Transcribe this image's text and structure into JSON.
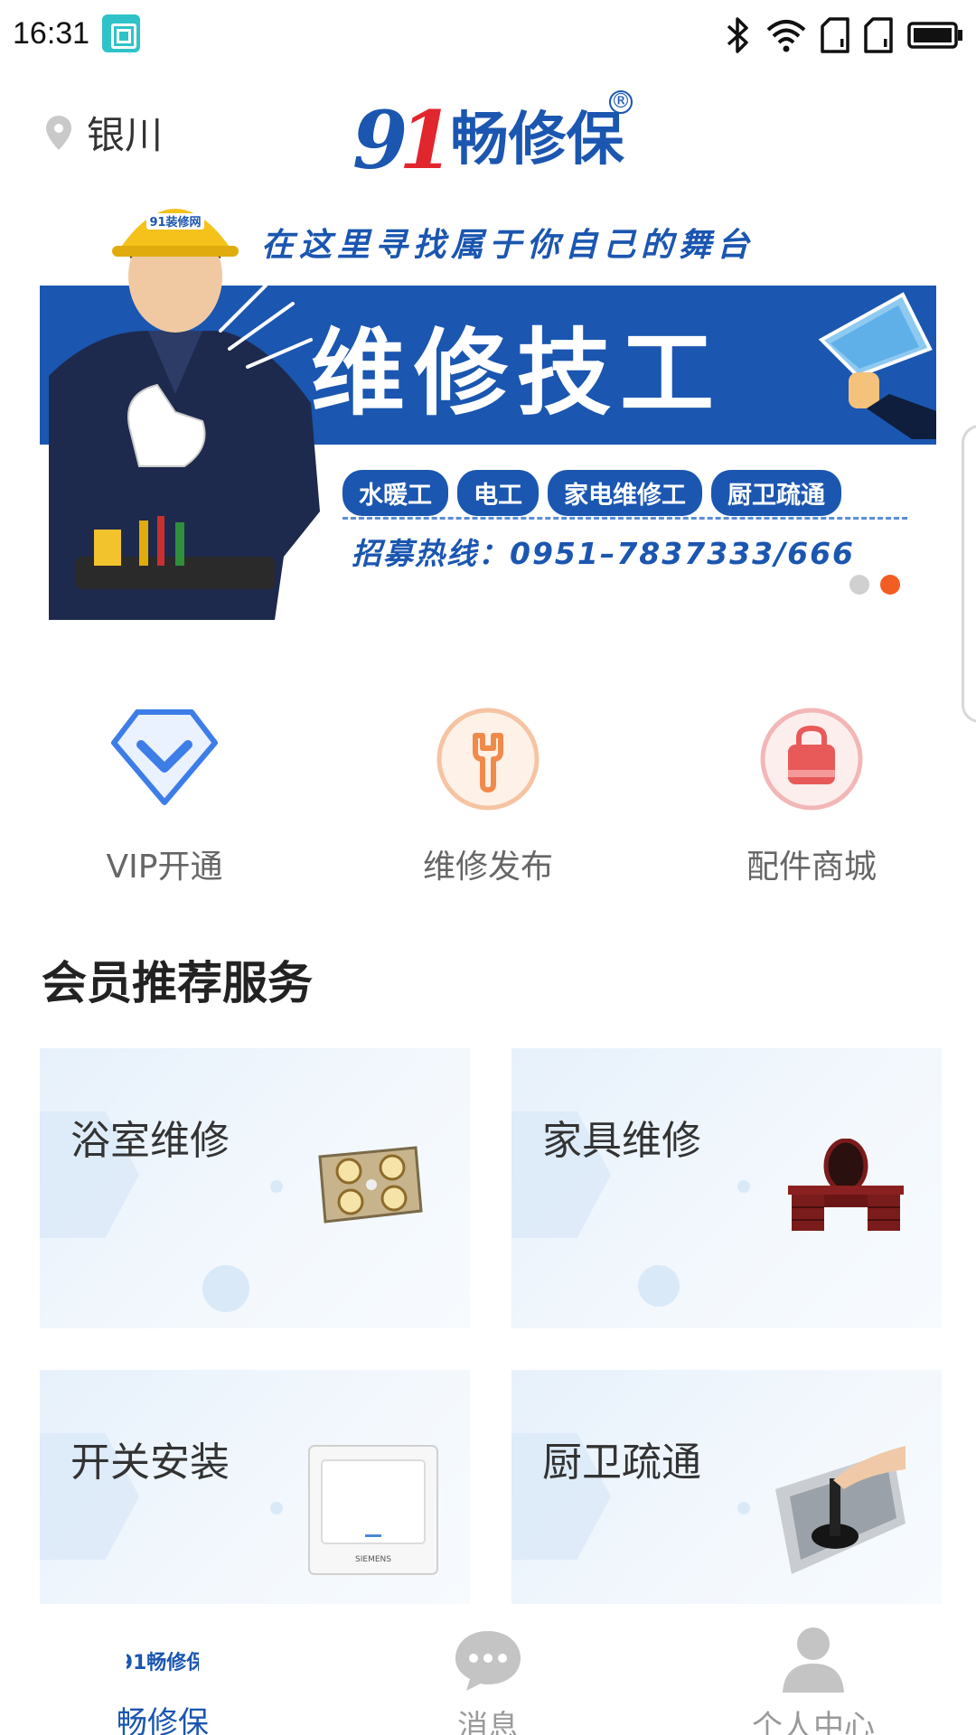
{
  "status_bar": {
    "time": "16:31",
    "icons": [
      "screenshot-icon",
      "bluetooth-icon",
      "wifi-icon",
      "sim1-icon",
      "sim2-icon",
      "battery-icon"
    ]
  },
  "header": {
    "location": "银川",
    "logo_number": "91",
    "logo_text": "畅修保",
    "logo_mark": "®"
  },
  "banner": {
    "tagline": "在这里寻找属于你自己的舞台",
    "headline": "维修技工",
    "chips": [
      "水暖工",
      "电工",
      "家电维修工",
      "厨卫疏通"
    ],
    "hotline": "招募热线：0951–7837333/666",
    "helmet_text": "91装修网",
    "slide_count": 2,
    "active_slide": 2
  },
  "quick_actions": [
    {
      "label": "VIP开通",
      "icon": "vip-diamond-icon",
      "color": "#3d7de8"
    },
    {
      "label": "维修发布",
      "icon": "wrench-icon",
      "color": "#f08a4b"
    },
    {
      "label": "配件商城",
      "icon": "shopping-bag-icon",
      "color": "#e85a5a"
    }
  ],
  "section": {
    "title": "会员推荐服务"
  },
  "services": [
    {
      "title": "浴室维修",
      "image": "bathroom-heater-image"
    },
    {
      "title": "家具维修",
      "image": "dresser-image"
    },
    {
      "title": "开关安装",
      "image": "wall-switch-image",
      "brand": "SIEMENS"
    },
    {
      "title": "厨卫疏通",
      "image": "sink-plunger-image"
    }
  ],
  "tabbar": [
    {
      "label": "畅修保",
      "icon": "home-logo-icon",
      "active": true
    },
    {
      "label": "消息",
      "icon": "chat-bubble-icon",
      "active": false
    },
    {
      "label": "个人中心",
      "icon": "person-icon",
      "active": false
    }
  ],
  "colors": {
    "brand_blue": "#1b56b0",
    "accent_orange": "#f25d22",
    "card_bg": "#eef5fc"
  }
}
